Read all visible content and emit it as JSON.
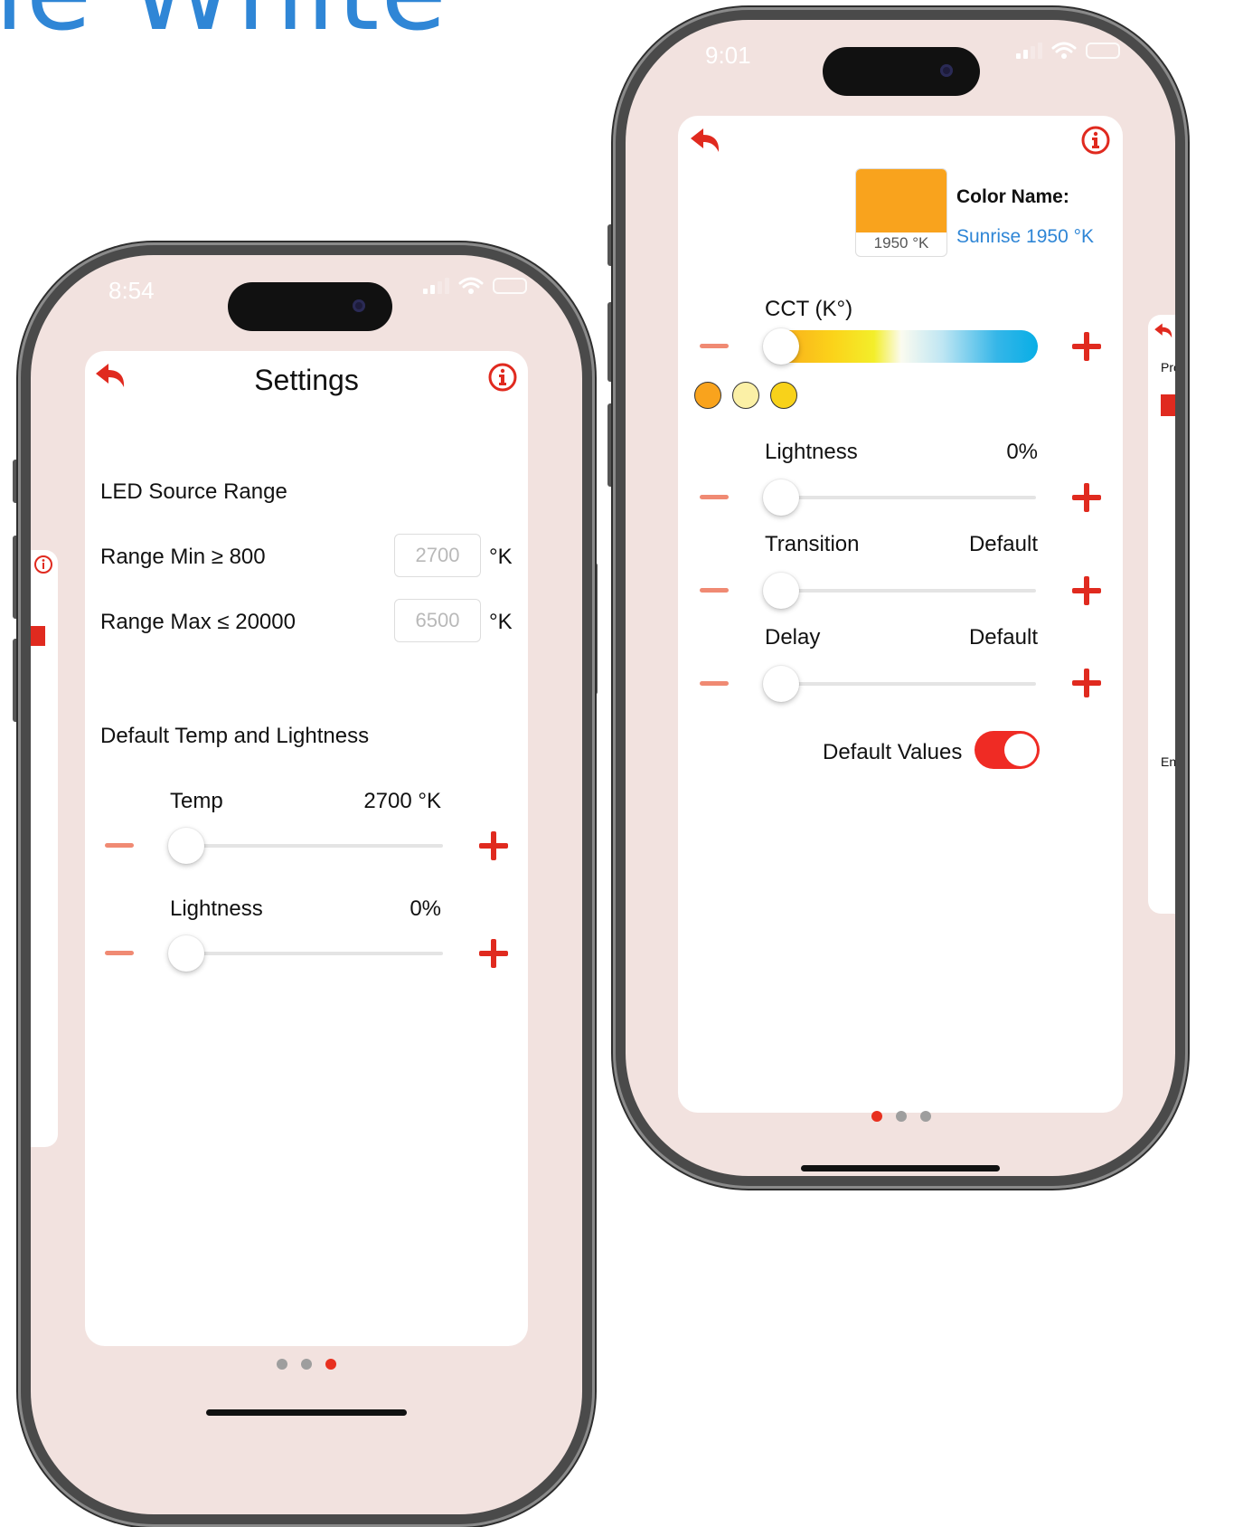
{
  "headline": "ie White",
  "colors": {
    "accent": "#e02a1f",
    "minus": "#f08a73",
    "link": "#2f86d6",
    "screen_bg": "#f2e2df",
    "swatch": "#f9a31d"
  },
  "left_phone": {
    "status_time": "8:54",
    "title": "Settings",
    "back_icon": "back-arrow-icon",
    "info_icon": "info-icon",
    "section_led": "LED Source Range",
    "range_min": {
      "label": "Range Min ≥ 800",
      "placeholder": "2700",
      "unit": "°K"
    },
    "range_max": {
      "label": "Range Max ≤ 20000",
      "placeholder": "6500",
      "unit": "°K"
    },
    "section_default": "Default Temp and Lightness",
    "temp": {
      "label": "Temp",
      "value": "2700 °K",
      "level": 0
    },
    "lightness": {
      "label": "Lightness",
      "value": "0%",
      "level": 0
    },
    "page_dots": {
      "count": 3,
      "active": 3
    }
  },
  "right_phone": {
    "status_time": "9:01",
    "back_icon": "back-arrow-icon",
    "info_icon": "info-icon",
    "swatch_label": "1950 °K",
    "color_name_label": "Color Name:",
    "color_name_value": "Sunrise 1950 °K",
    "cct": {
      "label": "CCT (K°)",
      "level": 0
    },
    "preset_dots": [
      "#f9a31d",
      "#fbf0a6",
      "#f8d21a"
    ],
    "lightness": {
      "label": "Lightness",
      "value": "0%",
      "level": 0
    },
    "transition": {
      "label": "Transition",
      "value": "Default",
      "level": 0
    },
    "delay": {
      "label": "Delay",
      "value": "Default",
      "level": 0
    },
    "default_values": {
      "label": "Default Values",
      "on": true
    },
    "page_dots": {
      "count": 3,
      "active": 1
    }
  },
  "peek_right": {
    "label_top": "Pro",
    "label_bottom": "En"
  }
}
